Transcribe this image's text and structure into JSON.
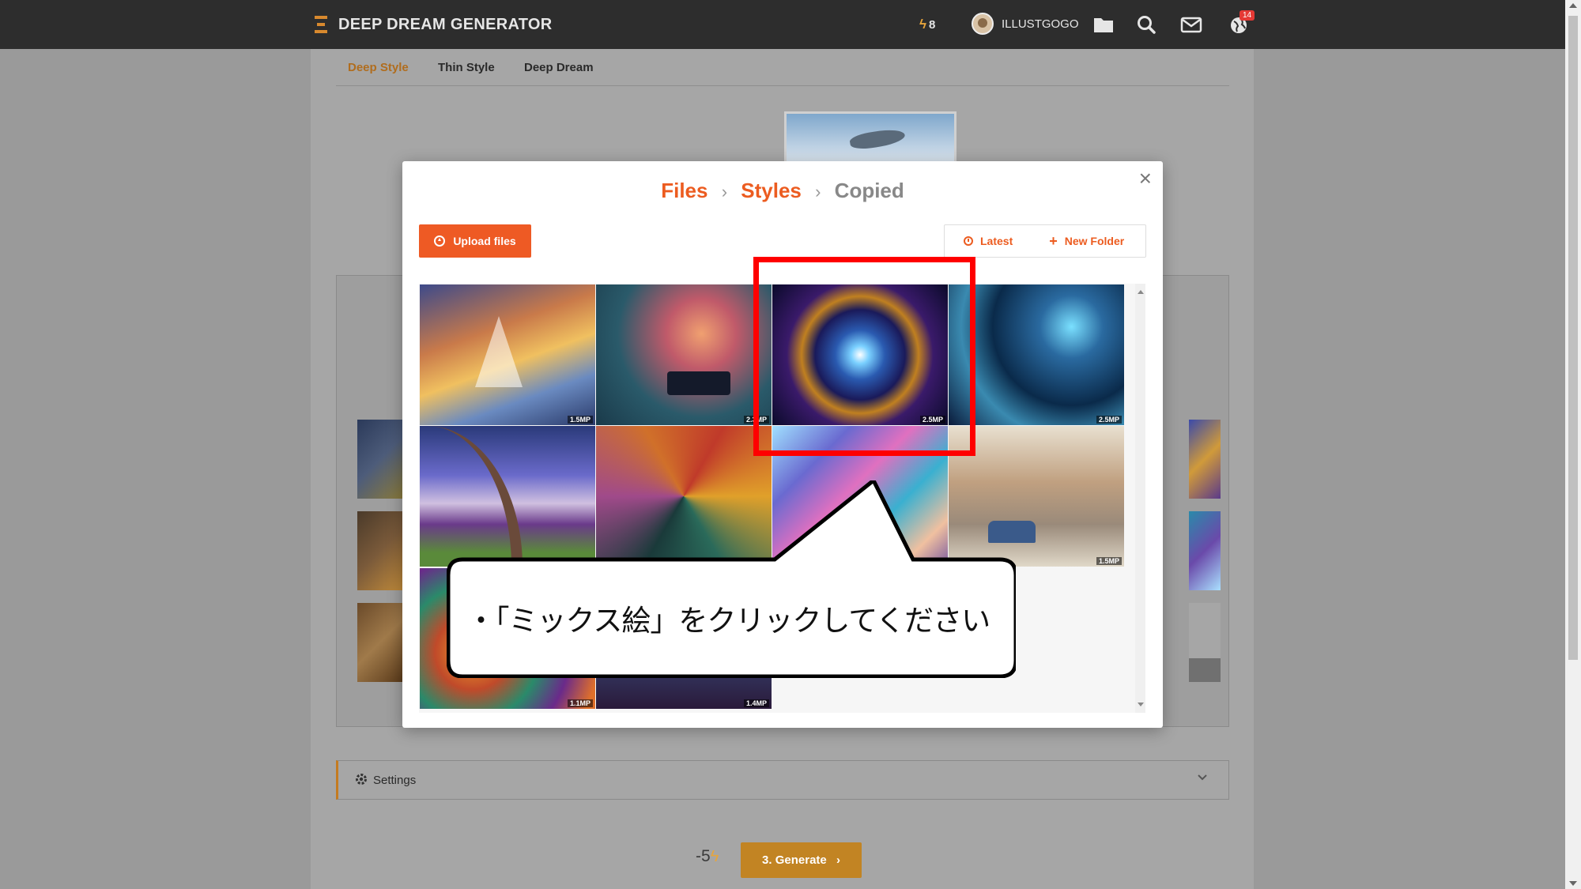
{
  "navbar": {
    "brand": "DEEP DREAM GENERATOR",
    "energy": "8",
    "username": "ILLUSTGOGO",
    "notification_count": "14"
  },
  "tabs": [
    {
      "label": "Deep Style",
      "active": true
    },
    {
      "label": "Thin Style",
      "active": false
    },
    {
      "label": "Deep Dream",
      "active": false
    }
  ],
  "modal": {
    "breadcrumb": [
      "Files",
      "Styles",
      "Copied"
    ],
    "upload_label": "Upload files",
    "latest_label": "Latest",
    "new_folder_label": "New Folder",
    "thumbnails": [
      {
        "name": "thumb-sailing-ship",
        "mp": "1.5MP"
      },
      {
        "name": "thumb-piano-jungle",
        "mp": "2.3MP"
      },
      {
        "name": "thumb-fractal-star",
        "mp": "2.5MP"
      },
      {
        "name": "thumb-blue-fractal",
        "mp": "2.5MP"
      },
      {
        "name": "thumb-tree-landscape",
        "mp": ""
      },
      {
        "name": "thumb-collage",
        "mp": ""
      },
      {
        "name": "thumb-mixed-art",
        "mp": ""
      },
      {
        "name": "thumb-street-sketch",
        "mp": "1.5MP"
      },
      {
        "name": "thumb-swirl",
        "mp": "1.1MP"
      },
      {
        "name": "thumb-dark-figure",
        "mp": "1.4MP"
      }
    ]
  },
  "settings": {
    "label": "Settings"
  },
  "generate": {
    "cost": "-5",
    "label": "3. Generate"
  },
  "annotation": {
    "text": "・「ミックス絵」をクリックしてください"
  },
  "colors": {
    "accent": "#ec5c20",
    "nav_bg": "#2d2d2d",
    "highlight": "#ff0000",
    "generate": "#c28423"
  }
}
